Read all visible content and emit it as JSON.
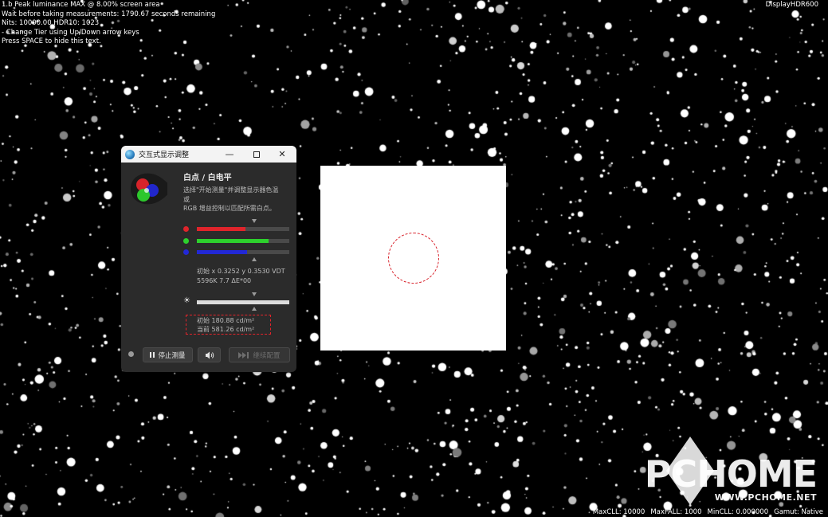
{
  "hud": {
    "lines": [
      "1.b Peak luminance MAX @ 8.00% screen area",
      "Wait before taking measurements: 1790.67 seconds remaining",
      "Nits: 10000.00  HDR10: 1023",
      "- Change Tier using Up/Down arrow keys",
      "Press SPACE to hide this text."
    ],
    "top_right": "DisplayHDR600",
    "bottom": [
      "MaxCLL: 10000",
      "MaxFALL: 1000",
      "MinCLL: 0.000000",
      "Gamut: Native"
    ]
  },
  "window": {
    "title": "交互式显示调整",
    "controls": {
      "minimize": "—",
      "close": "✕"
    },
    "heading": "白点 / 白电平",
    "description_lines": [
      "选择\"开始测量\"并调整显示器色温",
      "或",
      "RGB 增益控制以匹配所需白点。"
    ],
    "rgb_sliders": [
      {
        "name": "red",
        "color": "#e0242b",
        "level": 0.53
      },
      {
        "name": "green",
        "color": "#2dd12d",
        "level": 0.78
      },
      {
        "name": "blue",
        "color": "#2228d6",
        "level": 0.54
      }
    ],
    "readout_lines": [
      "初始 x 0.3252 y 0.3530 VDT",
      "5596K 7.7 ΔE*00"
    ],
    "brightness_level": 1.0,
    "luminance_lines": [
      "初始 180.88 cd/m²",
      "当前 581.26 cd/m²"
    ],
    "buttons": {
      "stop": "停止测量",
      "sound_icon": "speaker-icon",
      "continue": "继续配置"
    }
  },
  "watermark": {
    "brand": "PCHOME",
    "url": "WWW.PCHOME.NET"
  },
  "colors": {
    "accent_red": "#e3242b",
    "window_bg": "#2b2b2b",
    "titlebar_bg": "#f3f3f3"
  }
}
